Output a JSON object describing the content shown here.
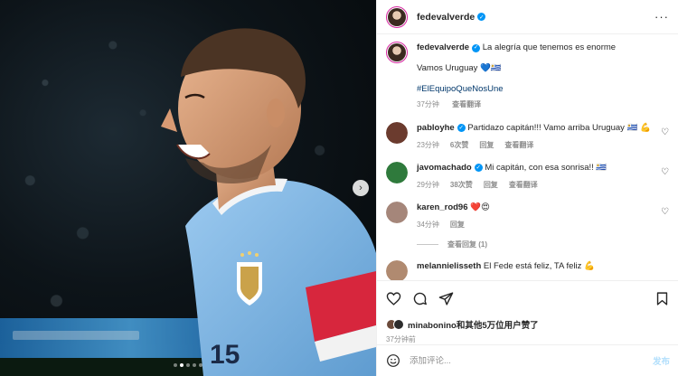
{
  "post": {
    "username": "fedevalverde",
    "caption_line1": "La alegría que tenemos es enorme",
    "caption_line2": "Vamos Uruguay 💙🇺🇾",
    "hashtag": "#ElEquipoQueNosUne",
    "time": "37分钟",
    "translate_label": "查看翻译"
  },
  "media": {
    "jersey_number": "15",
    "next_glyph": "›",
    "dots": 5,
    "active_dot": 1
  },
  "comments": [
    {
      "username": "pabloyhe",
      "verified": true,
      "text": "Partidazo capitán!!! Vamo arriba Uruguay 🇺🇾 💪",
      "time": "23分钟",
      "likes": "6次赞",
      "reply": "回复",
      "translate": "查看翻译",
      "avatar_color": "#6b3b2e"
    },
    {
      "username": "javomachado",
      "verified": true,
      "text": "Mi capitán, con esa sonrisa!! 🇺🇾",
      "time": "29分钟",
      "likes": "38次赞",
      "reply": "回复",
      "translate": "查看翻译",
      "avatar_color": "#2f7a3c"
    },
    {
      "username": "karen_rod96",
      "verified": false,
      "text": "❤️😍",
      "time": "34分钟",
      "likes": "",
      "reply": "回复",
      "translate": "",
      "avatar_color": "#a5867a"
    },
    {
      "username": "melannielisseth",
      "verified": false,
      "text": "El Fede está feliz, TA feliz 💪",
      "time": "",
      "likes": "",
      "reply": "",
      "translate": "",
      "avatar_color": "#b08a70"
    }
  ],
  "view_replies": "查看回复 (1)",
  "likes": {
    "text_user": "minabonino",
    "text_rest": "和其他5万位用户赞了"
  },
  "post_time": "37分钟前",
  "add_comment": {
    "placeholder": "添加评论...",
    "post_label": "发布"
  },
  "colors": {
    "verified": "#0095f6",
    "hashtag": "#00376b",
    "jersey": "#7fb4de",
    "armband": "#d7263d"
  }
}
